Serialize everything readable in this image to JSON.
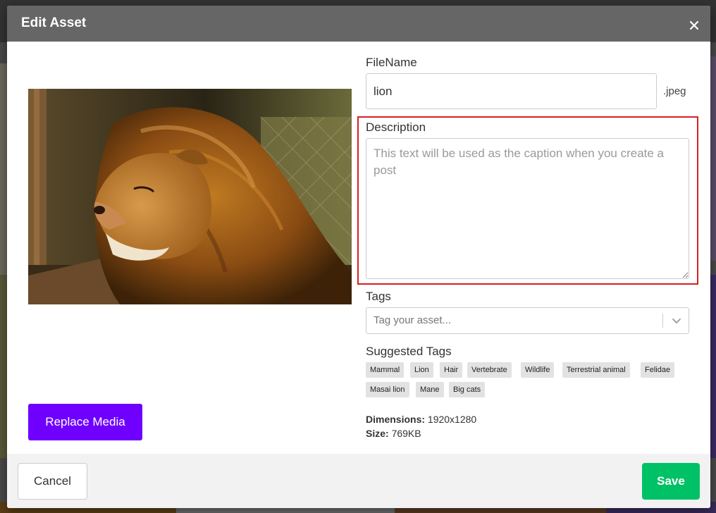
{
  "modal": {
    "title": "Edit Asset",
    "close_icon": "close-icon"
  },
  "preview": {
    "replace_label": "Replace Media"
  },
  "form": {
    "filename_label": "FileName",
    "filename_value": "lion",
    "extension": ".jpeg",
    "description_label": "Description",
    "description_value": "",
    "description_placeholder": "This text will be used as the caption when you create a post",
    "tags_label": "Tags",
    "tags_placeholder": "Tag your asset...",
    "suggested_label": "Suggested Tags",
    "suggested_tags": [
      "Mammal",
      "Lion",
      "Hair",
      "Vertebrate",
      "Wildlife",
      "Terrestrial animal",
      "Felidae",
      "Masai lion",
      "Mane",
      "Big cats"
    ]
  },
  "meta": {
    "dimensions_label": "Dimensions:",
    "dimensions_value": "1920x1280",
    "size_label": "Size:",
    "size_value": "769KB"
  },
  "footer": {
    "cancel_label": "Cancel",
    "save_label": "Save"
  },
  "colors": {
    "header_bg": "#666666",
    "replace_btn": "#6f00ff",
    "save_btn": "#00c165",
    "highlight": "#d81f1f"
  }
}
